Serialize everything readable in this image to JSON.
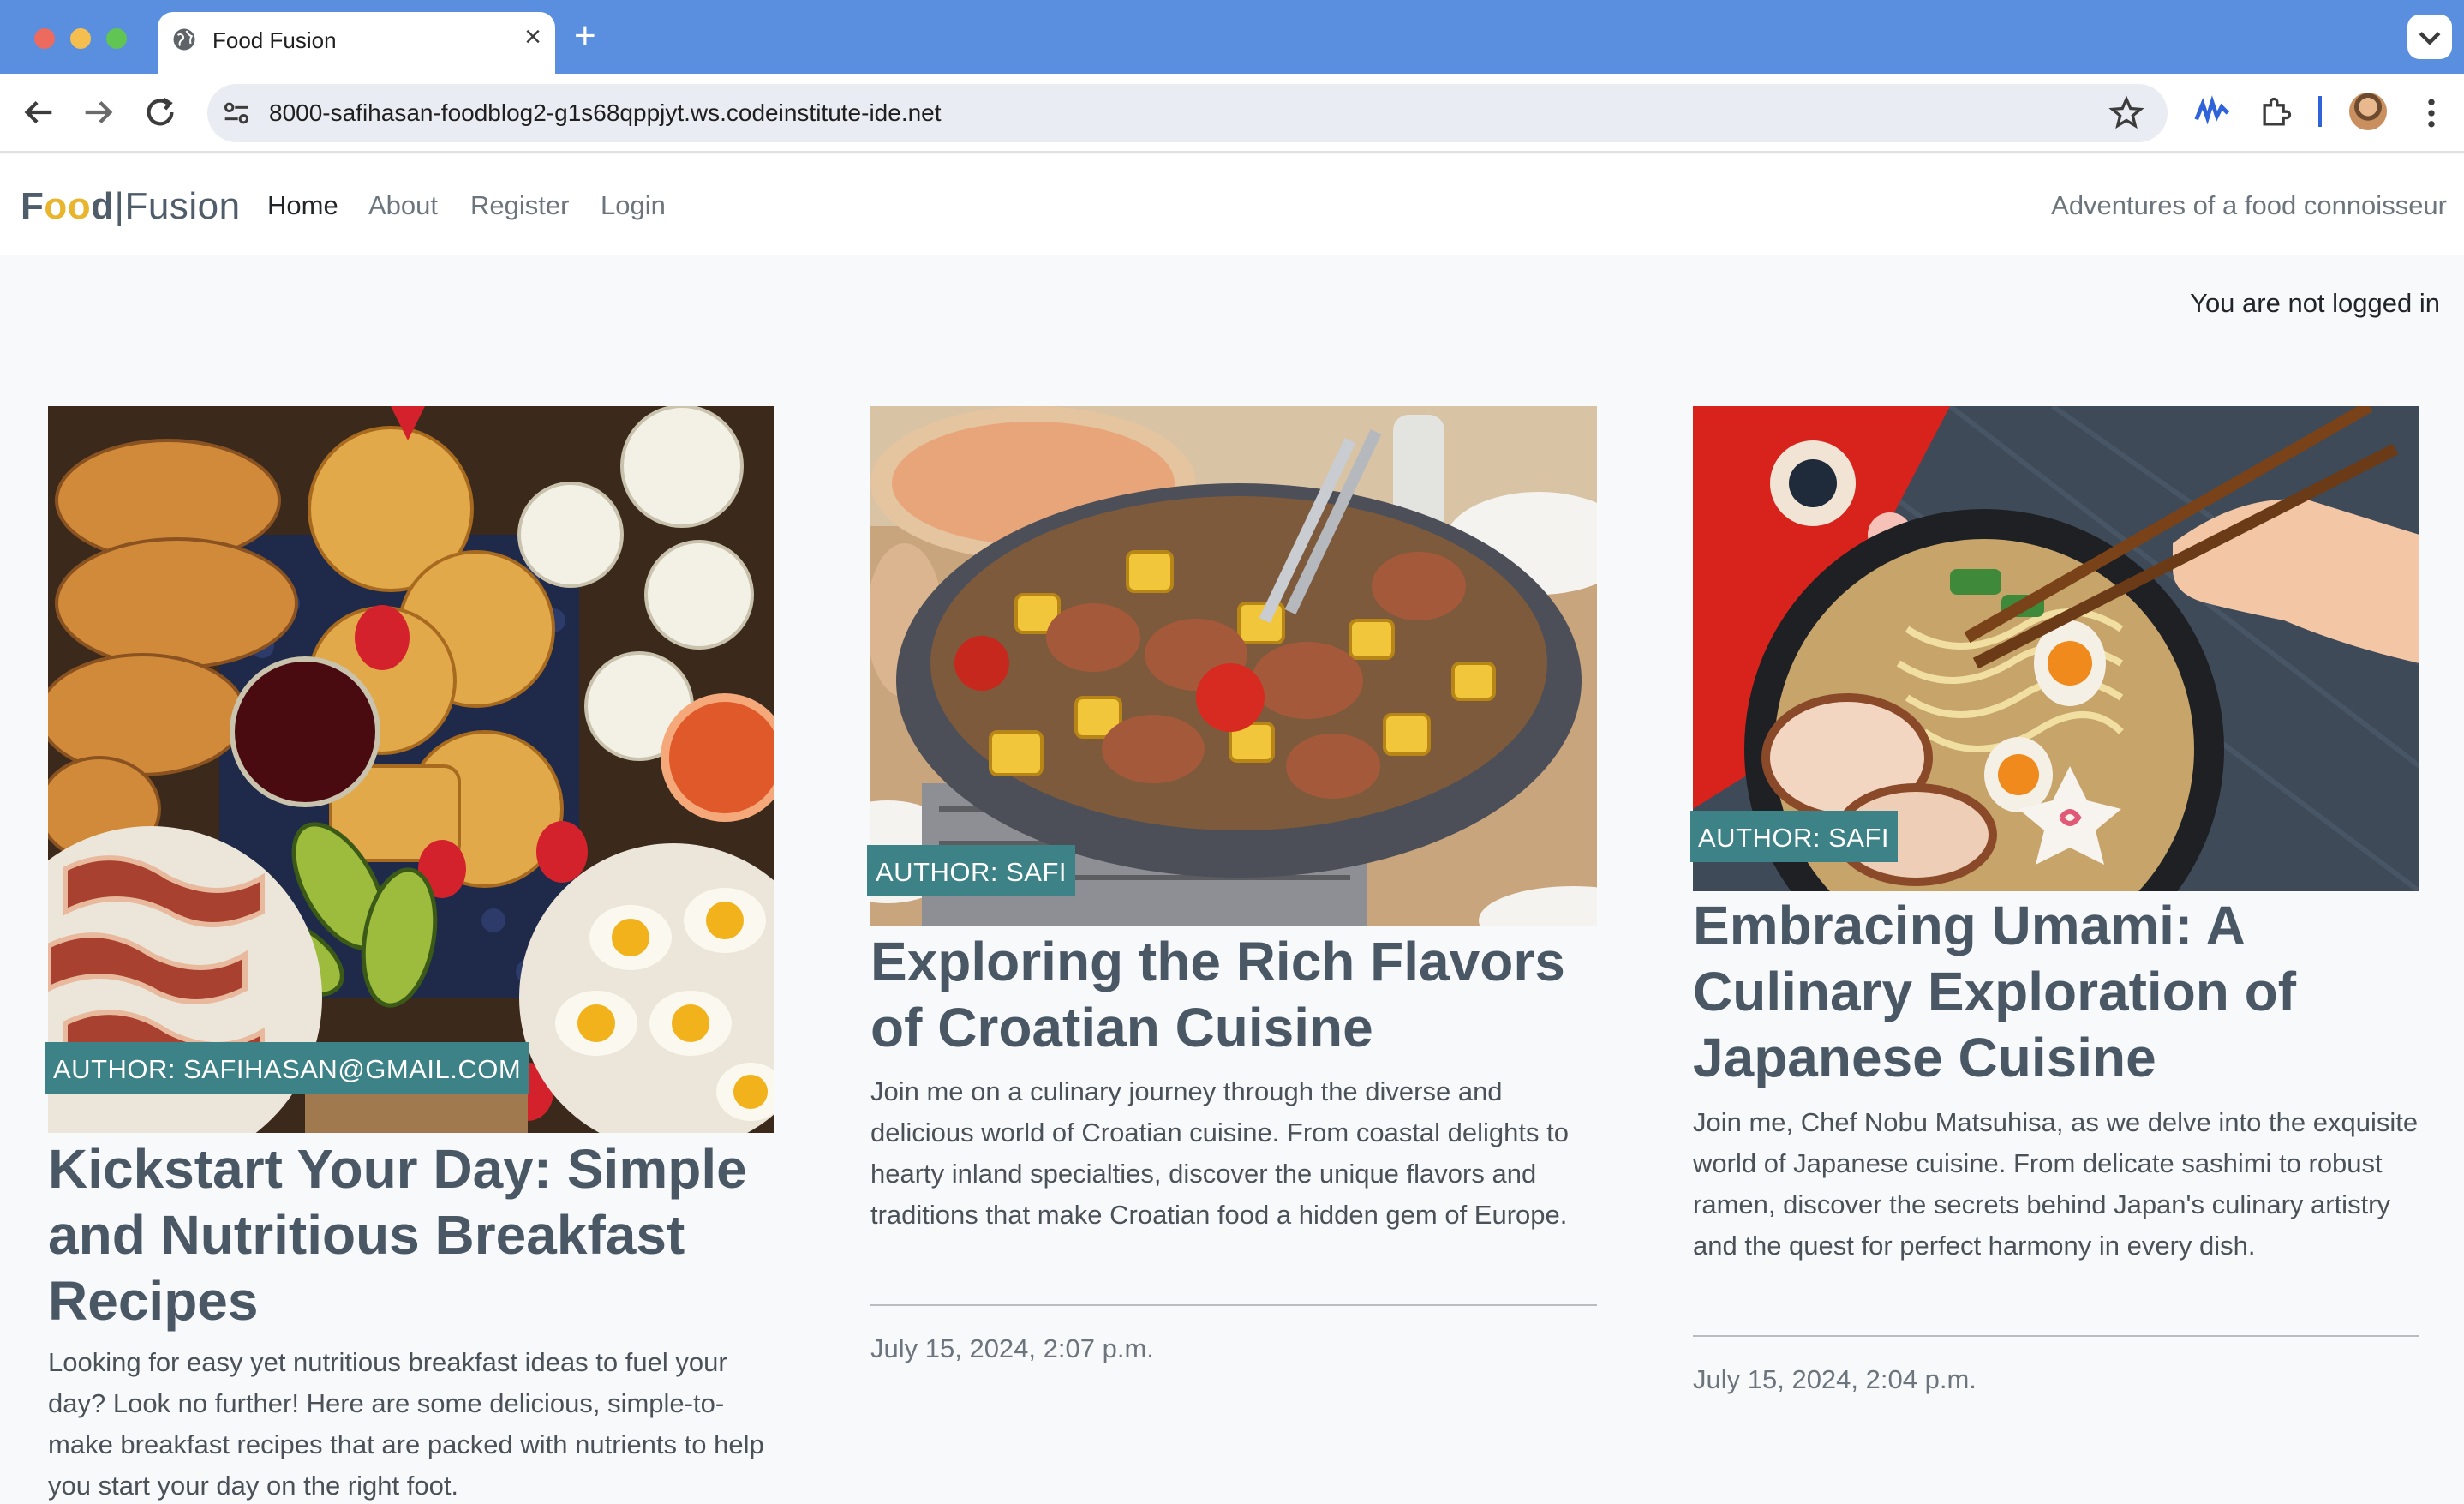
{
  "browser": {
    "tab_title": "Food Fusion",
    "new_tab": "+",
    "tab_close": "×",
    "url": "8000-safihasan-foodblog2-g1s68qppjyt.ws.codeinstitute-ide.net"
  },
  "site": {
    "brand_food_1": "F",
    "brand_food_2": "oo",
    "brand_food_3": "d",
    "brand_pipe": "|",
    "brand_fusion": "Fusion",
    "nav": [
      "Home",
      "About",
      "Register",
      "Login"
    ],
    "tagline": "Adventures of a food connoisseur",
    "login_status": "You are not logged in"
  },
  "posts": [
    {
      "author": "AUTHOR: SAFIHASAN@GMAIL.COM",
      "title": "Kickstart Your Day: Simple and Nutritious Breakfast Recipes",
      "excerpt": "Looking for easy yet nutritious breakfast ideas to fuel your day? Look no further! Here are some delicious, simple-to-make breakfast recipes that are packed with nutrients to help you start your day on the right foot.",
      "date": ""
    },
    {
      "author": "AUTHOR: SAFI",
      "title": "Exploring the Rich Flavors of Croatian Cuisine",
      "excerpt": "Join me on a culinary journey through the diverse and delicious world of Croatian cuisine. From coastal delights to hearty inland specialties, discover the unique flavors and traditions that make Croatian food a hidden gem of Europe.",
      "date": "July 15, 2024, 2:07 p.m."
    },
    {
      "author": "AUTHOR: SAFI",
      "title": "Embracing Umami: A Culinary Exploration of Japanese Cuisine",
      "excerpt": "Join me, Chef Nobu Matsuhisa, as we delve into the exquisite world of Japanese cuisine. From delicate sashimi to robust ramen, discover the secrets behind Japan's culinary artistry and the quest for perfect harmony in every dish.",
      "date": "July 15, 2024, 2:04 p.m."
    }
  ],
  "colors": {
    "chrome_blue": "#5a8fe0",
    "badge_teal": "#3c8286",
    "title_slate": "#4a5866",
    "brand_yellow": "#e8b52c"
  },
  "icons": [
    "globe-icon",
    "close-icon",
    "plus-icon",
    "chevron-down-icon",
    "back-arrow-icon",
    "forward-arrow-icon",
    "reload-icon",
    "site-info-icon",
    "star-icon",
    "extension-wave-icon",
    "puzzle-icon",
    "profile-avatar",
    "kebab-menu-icon"
  ]
}
